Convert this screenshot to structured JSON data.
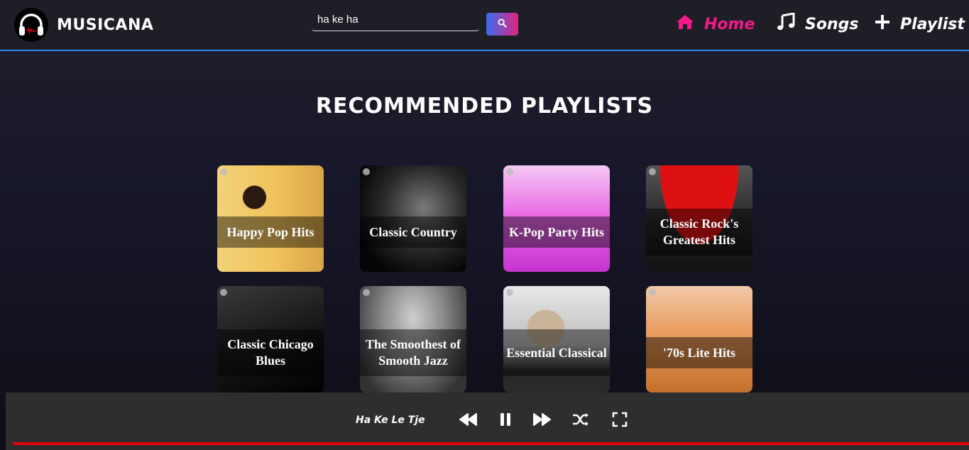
{
  "app": {
    "brand": "MUSICANA"
  },
  "search": {
    "value": "ha ke ha",
    "button_icon": "search-icon"
  },
  "nav": {
    "home": {
      "label": "Home",
      "icon": "home-icon",
      "color": "#f21a8a"
    },
    "songs": {
      "label": "Songs",
      "icon": "music-note-icon"
    },
    "playlist": {
      "label": "Playlist",
      "icon": "plus-icon"
    }
  },
  "main": {
    "title": "RECOMMENDED PLAYLISTS",
    "playlists": [
      {
        "title": "Happy Pop Hits"
      },
      {
        "title": "Classic Country"
      },
      {
        "title": "K-Pop Party Hits"
      },
      {
        "title": "Classic Rock's Greatest Hits"
      },
      {
        "title": "Classic Chicago Blues"
      },
      {
        "title": "The Smoothest of Smooth Jazz"
      },
      {
        "title": "Essential Classical"
      },
      {
        "title": "'70s Lite Hits"
      }
    ]
  },
  "player": {
    "track": "Ha Ke Le Tje",
    "controls": [
      "rewind-icon",
      "pause-icon",
      "fast-forward-icon",
      "shuffle-icon",
      "fullscreen-icon"
    ],
    "progress_color": "#e2000f"
  }
}
